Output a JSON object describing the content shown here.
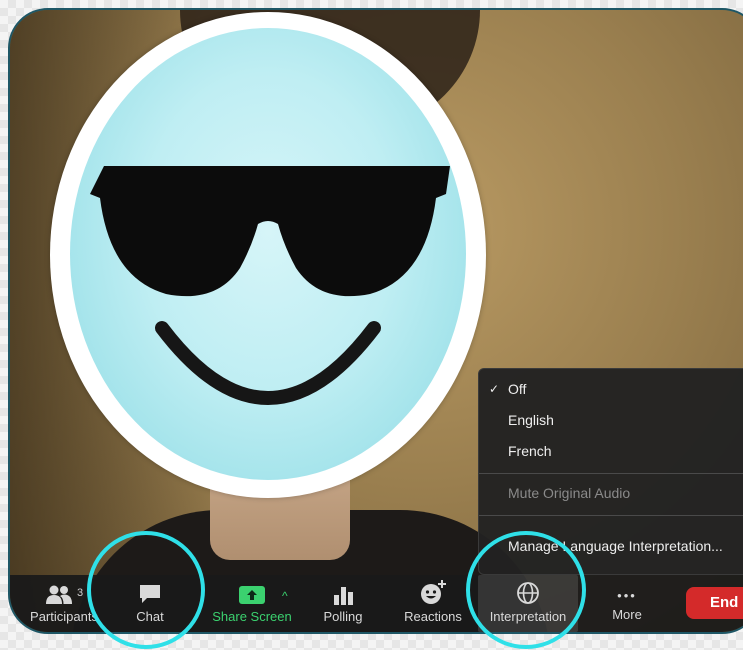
{
  "toolbar": {
    "participants": {
      "count": "3",
      "label": "Participants",
      "icon": "people-icon"
    },
    "chat": {
      "label": "Chat",
      "icon": "chat-bubble-icon"
    },
    "share_screen": {
      "label": "Share Screen",
      "icon": "share-arrow-icon",
      "caret": "^"
    },
    "polling": {
      "label": "Polling",
      "icon": "bar-chart-icon"
    },
    "reactions": {
      "label": "Reactions",
      "icon": "emoji-plus-icon"
    },
    "interpretation": {
      "label": "Interpretation",
      "icon": "globe-icon"
    },
    "more": {
      "label": "More",
      "icon": "ellipsis-icon",
      "glyph": "•••"
    },
    "end": {
      "label": "End"
    }
  },
  "interpretation_menu": {
    "items": [
      {
        "label": "Off",
        "checked": true,
        "check_glyph": "✓"
      },
      {
        "label": "English",
        "checked": false
      },
      {
        "label": "French",
        "checked": false
      }
    ],
    "mute_original_audio": "Mute Original Audio",
    "manage": "Manage Language Interpretation..."
  },
  "colors": {
    "highlight": "#2fe0e8",
    "share_green": "#3bd16f",
    "end_red": "#d42a2a",
    "face": "#bfeef3"
  }
}
